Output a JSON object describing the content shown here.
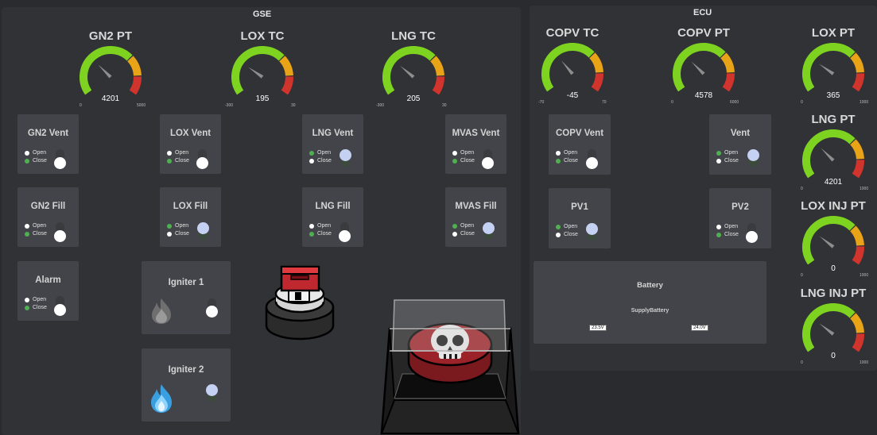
{
  "gse": {
    "title": "GSE",
    "gauges": [
      {
        "title": "GN2 PT",
        "value": "4201",
        "min": "0",
        "max": "5000"
      },
      {
        "title": "LOX TC",
        "value": "195",
        "min": "-300",
        "max": "30"
      },
      {
        "title": "LNG TC",
        "value": "205",
        "min": "-300",
        "max": "30"
      }
    ],
    "valves": [
      {
        "title": "GN2 Vent",
        "open": "Open",
        "close": "Close"
      },
      {
        "title": "LOX Vent",
        "open": "Open",
        "close": "Close"
      },
      {
        "title": "LNG Vent",
        "open": "Open",
        "close": "Close"
      },
      {
        "title": "MVAS Vent",
        "open": "Open",
        "close": "Close"
      },
      {
        "title": "GN2 Fill",
        "open": "Open",
        "close": "Close"
      },
      {
        "title": "LOX Fill",
        "open": "Open",
        "close": "Close"
      },
      {
        "title": "LNG Fill",
        "open": "Open",
        "close": "Close"
      },
      {
        "title": "MVAS Fill",
        "open": "Open",
        "close": "Close"
      },
      {
        "title": "Alarm",
        "open": "Open",
        "close": "Close"
      }
    ],
    "igniters": [
      {
        "title": "Igniter 1",
        "icon": "flame-gray-icon"
      },
      {
        "title": "Igniter 2",
        "icon": "flame-blue-icon"
      }
    ]
  },
  "ecu": {
    "title": "ECU",
    "gauges": [
      {
        "title": "COPV TC",
        "value": "-45",
        "min": "-70",
        "max": "70"
      },
      {
        "title": "COPV PT",
        "value": "4578",
        "min": "0",
        "max": "6000"
      },
      {
        "title": "LOX PT",
        "value": "365",
        "min": "0",
        "max": "1000"
      },
      {
        "title": "LNG PT",
        "value": "4201",
        "min": "0",
        "max": "1000"
      },
      {
        "title": "LOX INJ PT",
        "value": "0",
        "min": "0",
        "max": "1000"
      },
      {
        "title": "LNG INJ PT",
        "value": "0",
        "min": "0",
        "max": "1000"
      }
    ],
    "valves": [
      {
        "title": "COPV Vent",
        "open": "Open",
        "close": "Close"
      },
      {
        "title": "Vent",
        "open": "Open",
        "close": "Close"
      },
      {
        "title": "PV1",
        "open": "Open",
        "close": "Close"
      },
      {
        "title": "PV2",
        "open": "Open",
        "close": "Close"
      }
    ],
    "battery": {
      "title": "Battery",
      "subtitle": "SupplyBattery",
      "value1": "23.5V",
      "value2": "24.0V"
    }
  },
  "colors": {
    "green": "#7ed321",
    "orange": "#e8a317",
    "red": "#d0342c",
    "needle": "#8e8e8e"
  }
}
